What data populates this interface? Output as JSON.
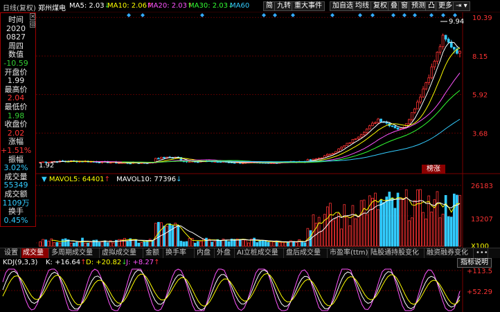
{
  "topbar": {
    "period": "日线(复权)",
    "stock_name": "郑州煤电",
    "ma": [
      {
        "label": "MA5: 2.03",
        "arrow": "↓",
        "color": "#ffffff",
        "arrow_color": "#33cc33"
      },
      {
        "label": "MA10: 2.06",
        "arrow": "↑",
        "color": "#ffff00",
        "arrow_color": "#ff3333"
      },
      {
        "label": "MA20: 2.03",
        "arrow": "↑",
        "color": "#ff55ff",
        "arrow_color": "#ff3333"
      },
      {
        "label": "MA30: 2.03",
        "arrow": "↓",
        "color": "#33ff33",
        "arrow_color": "#33cc33"
      },
      {
        "label": "MA60",
        "arrow": "",
        "color": "#33ccff",
        "arrow_color": "#33cc33"
      }
    ],
    "buttons": [
      "简",
      "九转",
      "重大事件",
      "加自选",
      "均线",
      "复权",
      "叠",
      "窗",
      "预测",
      "凸",
      "更多"
    ],
    "nav_icon": "⇥"
  },
  "info_panel": {
    "close_icon": "×",
    "gear_icon": "◎",
    "rows": [
      {
        "text": "时间",
        "color": "#e8e8e8"
      },
      {
        "text": "2020",
        "color": "#e8e8e8"
      },
      {
        "text": "0827",
        "color": "#e8e8e8"
      },
      {
        "text": "周四",
        "color": "#e8e8e8"
      },
      {
        "text": "数值",
        "color": "#e8e8e8"
      },
      {
        "text": "-10.59",
        "color": "#33cc33"
      },
      {
        "text": "开盘价",
        "color": "#e8e8e8"
      },
      {
        "text": "1.99",
        "color": "#e8e8e8"
      },
      {
        "text": "最高价",
        "color": "#e8e8e8"
      },
      {
        "text": "2.04",
        "color": "#ff3333"
      },
      {
        "text": "最低价",
        "color": "#e8e8e8"
      },
      {
        "text": "1.98",
        "color": "#33cc33"
      },
      {
        "text": "收盘价",
        "color": "#e8e8e8"
      },
      {
        "text": "2.02",
        "color": "#ff3333"
      },
      {
        "text": "涨幅",
        "color": "#e8e8e8"
      },
      {
        "text": "+1.51%",
        "color": "#ff3333"
      },
      {
        "text": "振幅",
        "color": "#e8e8e8"
      },
      {
        "text": "3.02%",
        "color": "#33ccff"
      },
      {
        "text": "成交量",
        "color": "#e8e8e8"
      },
      {
        "text": "55349",
        "color": "#33ccff"
      },
      {
        "text": "成交额",
        "color": "#e8e8e8"
      },
      {
        "text": "1109万",
        "color": "#33ccff"
      },
      {
        "text": "换手",
        "color": "#e8e8e8"
      },
      {
        "text": "0.45%",
        "color": "#33ccff"
      }
    ]
  },
  "price_axis": {
    "ticks": [
      "10.39",
      "8.15",
      "5.92",
      "3.68"
    ],
    "high_label": "9.94",
    "low_label": "1.92"
  },
  "badge": "榜涨",
  "volume_panel": {
    "mavol5": "MAVOL5: 64401",
    "mavol5_arrow": "↑",
    "mavol10": "MAVOL10: 77396",
    "mavol10_arrow": "↓",
    "axis": [
      "26183",
      "13207",
      "X100"
    ]
  },
  "tabs": [
    "设置",
    "成交量",
    "多周期成交量",
    "虚拟成交量",
    "金额",
    "换手率",
    "内盘",
    "外盘",
    "AI立桩成交量",
    "盘后成交量",
    "市盈率(ttm)",
    "陆股通持股变化",
    "融资融券变化",
    "•••"
  ],
  "active_tab": 1,
  "kdj": {
    "label": "KDJ(9,3,3)",
    "k": "K: +16.64",
    "k_arrow": "↑",
    "d": "D: +20.82",
    "d_arrow": "↓",
    "j": "J: +8.27",
    "j_arrow": "↑",
    "help": "指标说明",
    "axis": [
      "+113.5",
      "+52.29"
    ]
  },
  "colors": {
    "up": "#ff3333",
    "down": "#33ccff",
    "grid": "#5a0000",
    "ma5": "#ffffff",
    "ma10": "#ffff00",
    "ma20": "#ff55ff",
    "ma30": "#33ff33",
    "ma60": "#33ccff",
    "kdj_k": "#ffffff",
    "kdj_d": "#ffff00",
    "kdj_j": "#ff55ff"
  }
}
